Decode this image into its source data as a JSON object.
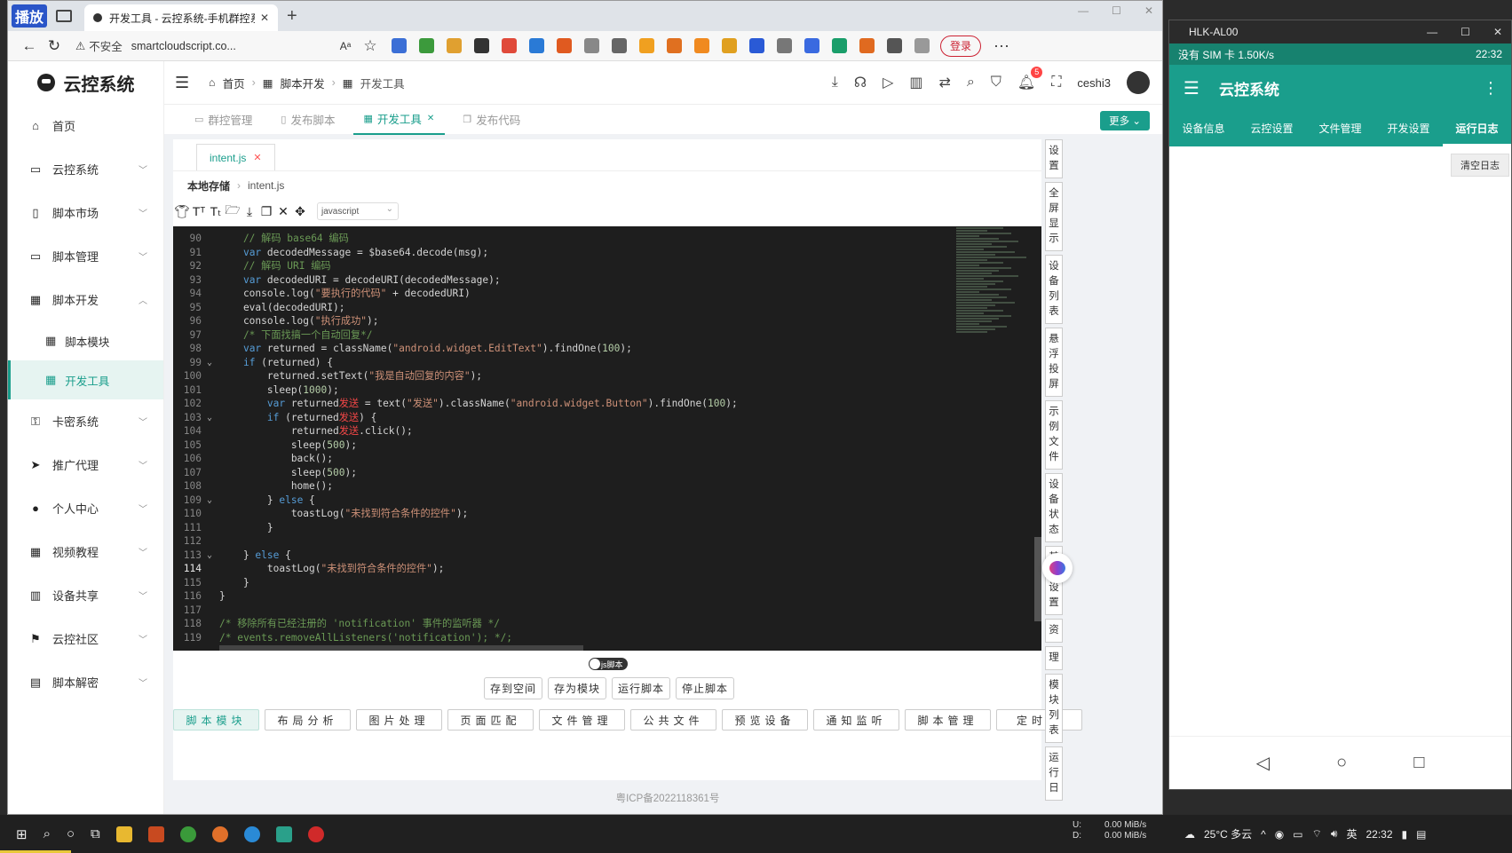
{
  "browser": {
    "recording_badge": "播放",
    "tab_title": "开发工具 - 云控系统-手机群控系",
    "not_secure": "不安全",
    "url": "smartcloudscript.co...",
    "login_label": "登录"
  },
  "sidebar": {
    "logo": "云控系统",
    "items": [
      {
        "label": "首页",
        "icon": "home-icon"
      },
      {
        "label": "云控系统",
        "icon": "monitor-icon"
      },
      {
        "label": "脚本市场",
        "icon": "phone-icon"
      },
      {
        "label": "脚本管理",
        "icon": "screen-icon"
      },
      {
        "label": "脚本开发",
        "icon": "grid-icon"
      }
    ],
    "sub_items": [
      {
        "label": "脚本模块"
      },
      {
        "label": "开发工具"
      }
    ],
    "items_after": [
      {
        "label": "卡密系统",
        "icon": "key-icon"
      },
      {
        "label": "推广代理",
        "icon": "send-icon"
      },
      {
        "label": "个人中心",
        "icon": "user-icon"
      },
      {
        "label": "视频教程",
        "icon": "grid-icon"
      },
      {
        "label": "设备共享",
        "icon": "building-icon"
      },
      {
        "label": "云控社区",
        "icon": "flag-icon"
      },
      {
        "label": "脚本解密",
        "icon": "document-icon"
      }
    ]
  },
  "header": {
    "breadcrumbs": [
      "首页",
      "脚本开发",
      "开发工具"
    ],
    "notification_count": "5",
    "username": "ceshi3"
  },
  "tabs_view": {
    "tabs": [
      {
        "label": "群控管理"
      },
      {
        "label": "发布脚本"
      },
      {
        "label": "开发工具"
      },
      {
        "label": "发布代码"
      }
    ],
    "more": "更多"
  },
  "editor": {
    "file_tab": "intent.js",
    "path_root": "本地存储",
    "path_file": "intent.js",
    "language": "javascript",
    "lines": [
      {
        "n": "90",
        "text": "    // 解码 base64 编码",
        "fold": ""
      },
      {
        "n": "91",
        "text": "    var decodedMessage = $base64.decode(msg);",
        "fold": ""
      },
      {
        "n": "92",
        "text": "    // 解码 URI 编码",
        "fold": ""
      },
      {
        "n": "93",
        "text": "    var decodedURI = decodeURI(decodedMessage);",
        "fold": ""
      },
      {
        "n": "94",
        "text": "    console.log(\"要执行的代码\" + decodedURI)",
        "fold": ""
      },
      {
        "n": "95",
        "text": "    eval(decodedURI);",
        "fold": ""
      },
      {
        "n": "96",
        "text": "    console.log(\"执行成功\");",
        "fold": ""
      },
      {
        "n": "97",
        "text": "    /* 下面找搞一个自动回复*/",
        "fold": ""
      },
      {
        "n": "98",
        "text": "    var returned = className(\"android.widget.EditText\").findOne(100);",
        "fold": ""
      },
      {
        "n": "99",
        "text": "    if (returned) {",
        "fold": "⌄"
      },
      {
        "n": "100",
        "text": "        returned.setText(\"我是自动回复的内容\");",
        "fold": ""
      },
      {
        "n": "101",
        "text": "        sleep(1000);",
        "fold": ""
      },
      {
        "n": "102",
        "text": "        var returned发送 = text(\"发送\").className(\"android.widget.Button\").findOne(100);",
        "fold": ""
      },
      {
        "n": "103",
        "text": "        if (returned发送) {",
        "fold": "⌄"
      },
      {
        "n": "104",
        "text": "            returned发送.click();",
        "fold": ""
      },
      {
        "n": "105",
        "text": "            sleep(500);",
        "fold": ""
      },
      {
        "n": "106",
        "text": "            back();",
        "fold": ""
      },
      {
        "n": "107",
        "text": "            sleep(500);",
        "fold": ""
      },
      {
        "n": "108",
        "text": "            home();",
        "fold": ""
      },
      {
        "n": "109",
        "text": "        } else {",
        "fold": "⌄"
      },
      {
        "n": "110",
        "text": "            toastLog(\"未找到符合条件的控件\");",
        "fold": ""
      },
      {
        "n": "111",
        "text": "        }",
        "fold": ""
      },
      {
        "n": "112",
        "text": "",
        "fold": ""
      },
      {
        "n": "113",
        "text": "    } else {",
        "fold": "⌄"
      },
      {
        "n": "114",
        "text": "        toastLog(\"未找到符合条件的控件\");",
        "fold": ""
      },
      {
        "n": "115",
        "text": "    }",
        "fold": ""
      },
      {
        "n": "116",
        "text": "}",
        "fold": ""
      },
      {
        "n": "117",
        "text": "",
        "fold": ""
      },
      {
        "n": "118",
        "text": "/* 移除所有已经注册的 'notification' 事件的监听器 */",
        "fold": ""
      },
      {
        "n": "119",
        "text": "/* events.removeAllListeners('notification'); */;",
        "fold": ""
      }
    ],
    "current_line": "114"
  },
  "actions": {
    "toggle_label": "js脚本",
    "buttons": [
      "存到空间",
      "存为模块",
      "运行脚本",
      "停止脚本"
    ]
  },
  "modules": [
    "脚本模块",
    "布局分析",
    "图片处理",
    "页面匹配",
    "文件管理",
    "公共文件",
    "预览设备",
    "通知监听",
    "脚本管理",
    "定时任"
  ],
  "right_rail": [
    "设置",
    "全屏显示",
    "设备列表",
    "悬浮投屏",
    "示例文件",
    "设备状态",
    "基础设置",
    "资",
    "理",
    "模块列表",
    "运行日"
  ],
  "footer": "粤ICP备2022118361号",
  "phone": {
    "window_title": "HLK-AL00",
    "status_left": "没有 SIM 卡  1.50K/s",
    "status_right": "22:32",
    "app_title": "云控系统",
    "tabs": [
      "设备信息",
      "云控设置",
      "文件管理",
      "开发设置",
      "运行日志"
    ],
    "clear_log": "清空日志"
  },
  "taskbar": {
    "upload": "U:",
    "download": "D:",
    "upload_speed": "0.00 MiB/s",
    "download_speed": "0.00 MiB/s",
    "weather": "25°C 多云",
    "ime": "英",
    "clock": "22:32"
  },
  "colors": {
    "accent": "#1a9e8c",
    "code_bg": "#1e1e1e",
    "comment": "#6a9955",
    "keyword": "#569cd6",
    "string": "#ce9178"
  }
}
